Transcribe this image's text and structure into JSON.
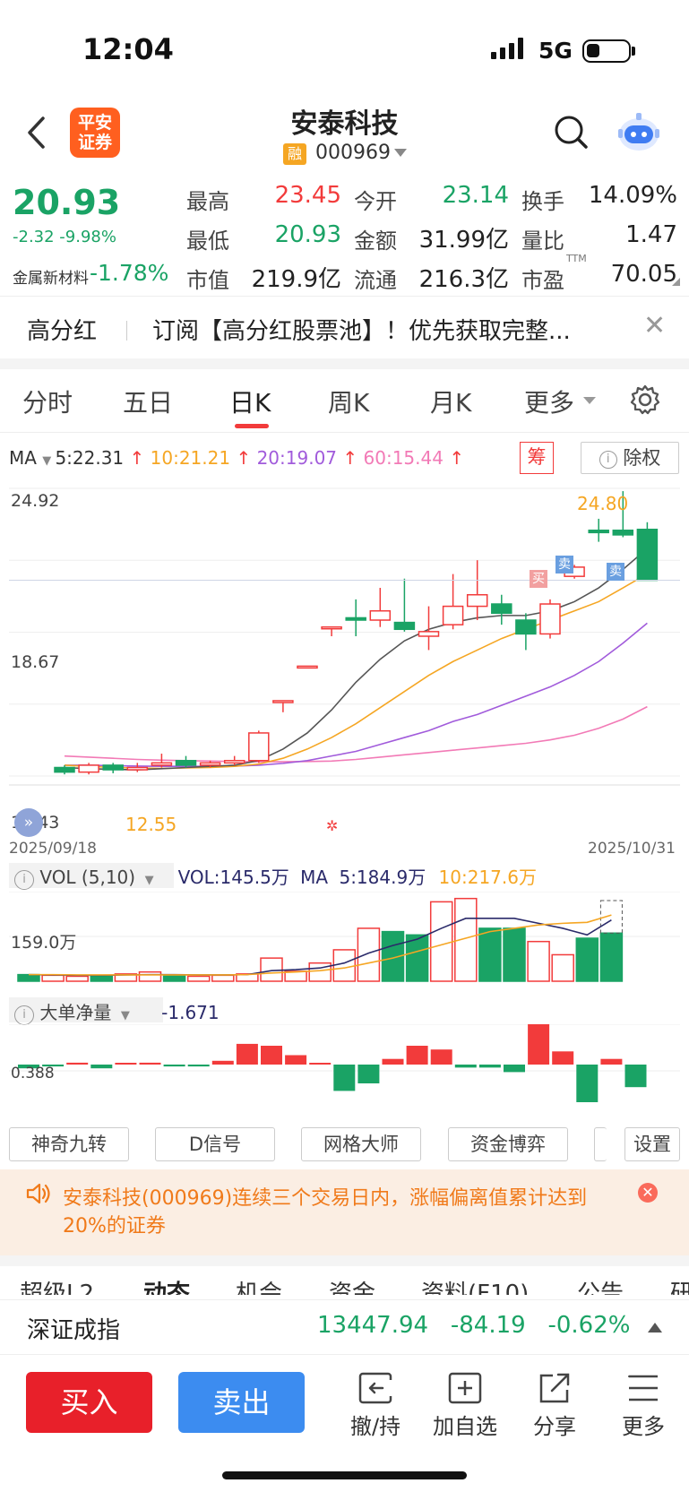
{
  "status_bar": {
    "time": "12:04",
    "network": "5G"
  },
  "header": {
    "logo_line1": "平安",
    "logo_line2": "证券",
    "stock_name": "安泰科技",
    "margin_tag": "融",
    "stock_code": "000969"
  },
  "quote": {
    "price": "20.93",
    "change": "-2.32  -9.98%",
    "sector_name": "金属新材料",
    "sector_change": "-1.78%",
    "fields": [
      {
        "label": "最高",
        "value": "23.45",
        "color": "#f23b3b"
      },
      {
        "label": "今开",
        "value": "23.14",
        "color": "#1aa365"
      },
      {
        "label": "换手",
        "value": "14.09%",
        "color": "#222222"
      },
      {
        "label": "最低",
        "value": "20.93",
        "color": "#1aa365"
      },
      {
        "label": "金额",
        "value": "31.99亿",
        "color": "#222222"
      },
      {
        "label": "量比",
        "value": "1.47",
        "color": "#222222"
      },
      {
        "label": "市值",
        "value": "219.9亿",
        "color": "#222222"
      },
      {
        "label": "流通",
        "value": "216.3亿",
        "color": "#222222"
      },
      {
        "label": "市盈",
        "value": "70.05",
        "color": "#222222"
      }
    ],
    "pe_suffix": "TTM"
  },
  "subscription": {
    "tag": "高分红",
    "text": "订阅【高分红股票池】！优先获取完整..."
  },
  "chart_tabs": [
    "分时",
    "五日",
    "日K",
    "周K",
    "月K",
    "更多"
  ],
  "chart_tabs_active": "日K",
  "ma_row": {
    "label": "MA",
    "ma5": "5:22.31",
    "ma10": "10:21.21",
    "ma20": "20:19.07",
    "ma60": "60:15.44",
    "chip_button": "筹",
    "rights_button": "除权"
  },
  "kline": {
    "y_high_label": "24.92",
    "y_mid_label": "18.67",
    "y_low_label": "12.43",
    "high_marker": "24.80",
    "low_marker": "12.55",
    "buy_tag": "买",
    "sell_tag": "卖",
    "start_date": "2025/09/18",
    "end_date": "2025/10/31"
  },
  "volume": {
    "label": "VOL (5,10)",
    "vol": "VOL:145.5万",
    "ma_label": "MA",
    "ma5": "5:184.9万",
    "ma10": "10:217.6万",
    "y_label": "159.0万"
  },
  "indicator": {
    "label": "大单净量",
    "value": "-1.671",
    "y_label": "0.388"
  },
  "tool_buttons": [
    "神奇九转",
    "D信号",
    "网格大师",
    "资金博弈",
    "设置"
  ],
  "alert": {
    "text": "安泰科技(000969)连续三个交易日内，涨幅偏离值累计达到20%的证券"
  },
  "info_tabs": [
    "超级L2",
    "动态",
    "机会",
    "资金",
    "资料(F10)",
    "公告",
    "研"
  ],
  "index_bar": {
    "name": "深证成指",
    "value": "13447.94",
    "change": "-84.19",
    "pct": "-0.62%"
  },
  "bottom_bar": {
    "buy": "买入",
    "sell": "卖出",
    "items": [
      "撤/持",
      "加自选",
      "分享",
      "更多"
    ]
  },
  "colors": {
    "up": "#f23b3b",
    "down": "#1aa365",
    "accent": "#e8202a",
    "sell_blue": "#3c8cf0"
  },
  "chart_data": [
    {
      "type": "candlestick",
      "title": "",
      "x_range": [
        "2025/09/18",
        "2025/10/31"
      ],
      "y_axis_labels": [
        "24.92",
        "18.67",
        "12.43"
      ],
      "ylim": [
        12.43,
        24.92
      ],
      "candles": [
        {
          "o": 12.8,
          "c": 12.6,
          "h": 12.9,
          "l": 12.5
        },
        {
          "o": 12.6,
          "c": 12.9,
          "h": 13.0,
          "l": 12.5
        },
        {
          "o": 12.9,
          "c": 12.7,
          "h": 13.0,
          "l": 12.55
        },
        {
          "o": 12.7,
          "c": 12.8,
          "h": 13.0,
          "l": 12.6
        },
        {
          "o": 12.9,
          "c": 13.0,
          "h": 13.4,
          "l": 12.8
        },
        {
          "o": 13.1,
          "c": 12.9,
          "h": 13.3,
          "l": 12.8
        },
        {
          "o": 12.9,
          "c": 13.0,
          "h": 13.1,
          "l": 12.8
        },
        {
          "o": 13.0,
          "c": 13.1,
          "h": 13.3,
          "l": 12.9
        },
        {
          "o": 13.1,
          "c": 14.3,
          "h": 14.4,
          "l": 13.0
        },
        {
          "o": 15.7,
          "c": 15.7,
          "h": 15.7,
          "l": 15.2
        },
        {
          "o": 17.2,
          "c": 17.2,
          "h": 17.2,
          "l": 17.2
        },
        {
          "o": 18.9,
          "c": 18.9,
          "h": 18.9,
          "l": 18.5
        },
        {
          "o": 19.3,
          "c": 19.2,
          "h": 20.1,
          "l": 18.5
        },
        {
          "o": 19.2,
          "c": 19.6,
          "h": 20.6,
          "l": 18.9
        },
        {
          "o": 19.1,
          "c": 18.8,
          "h": 21.0,
          "l": 18.7
        },
        {
          "o": 18.5,
          "c": 18.7,
          "h": 19.8,
          "l": 17.9
        },
        {
          "o": 19.0,
          "c": 19.8,
          "h": 21.2,
          "l": 18.8
        },
        {
          "o": 19.8,
          "c": 20.3,
          "h": 21.8,
          "l": 19.2
        },
        {
          "o": 19.9,
          "c": 19.5,
          "h": 20.3,
          "l": 19.0
        },
        {
          "o": 19.2,
          "c": 18.6,
          "h": 19.5,
          "l": 17.9
        },
        {
          "o": 18.6,
          "c": 19.9,
          "h": 20.1,
          "l": 18.4
        },
        {
          "o": 21.1,
          "c": 21.5,
          "h": 21.6,
          "l": 21.0
        },
        {
          "o": 23.1,
          "c": 23.0,
          "h": 23.6,
          "l": 22.6
        },
        {
          "o": 23.1,
          "c": 22.9,
          "h": 24.8,
          "l": 22.8
        },
        {
          "o": 23.14,
          "c": 20.93,
          "h": 23.45,
          "l": 20.93
        }
      ],
      "ma5": [
        12.8,
        12.75,
        12.72,
        12.7,
        12.75,
        12.8,
        12.85,
        12.9,
        13.1,
        13.6,
        14.3,
        15.3,
        16.5,
        17.5,
        18.3,
        18.8,
        19.1,
        19.3,
        19.4,
        19.4,
        19.6,
        20.0,
        20.6,
        21.4,
        22.31
      ],
      "ma10": [
        12.9,
        12.85,
        12.8,
        12.78,
        12.76,
        12.78,
        12.8,
        12.85,
        12.95,
        13.2,
        13.6,
        14.1,
        14.7,
        15.4,
        16.1,
        16.8,
        17.4,
        17.9,
        18.4,
        18.8,
        19.2,
        19.6,
        20.0,
        20.6,
        21.21
      ],
      "ma20": [
        12.9,
        12.9,
        12.88,
        12.86,
        12.85,
        12.85,
        12.85,
        12.86,
        12.9,
        12.98,
        13.1,
        13.3,
        13.5,
        13.8,
        14.1,
        14.4,
        14.8,
        15.1,
        15.5,
        15.9,
        16.3,
        16.8,
        17.4,
        18.2,
        19.07
      ],
      "ma60": [
        13.3,
        13.25,
        13.2,
        13.15,
        13.12,
        13.1,
        13.08,
        13.06,
        13.05,
        13.05,
        13.06,
        13.08,
        13.15,
        13.25,
        13.35,
        13.45,
        13.55,
        13.65,
        13.75,
        13.85,
        14.0,
        14.2,
        14.5,
        14.9,
        15.44
      ]
    },
    {
      "type": "bar",
      "title": "VOL (5,10)",
      "y_axis_labels": [
        "159.0万"
      ],
      "unit": "万",
      "values": [
        20,
        18,
        15,
        18,
        22,
        28,
        18,
        15,
        18,
        22,
        70,
        30,
        55,
        95,
        160,
        150,
        140,
        240,
        250,
        160,
        160,
        120,
        80,
        130,
        145.5
      ],
      "up": [
        false,
        true,
        true,
        false,
        true,
        true,
        false,
        true,
        true,
        true,
        true,
        true,
        true,
        true,
        true,
        false,
        false,
        true,
        true,
        false,
        false,
        true,
        true,
        false,
        false
      ],
      "ma5": [
        20,
        19,
        18,
        18,
        19,
        20,
        20,
        19,
        19,
        20,
        32,
        35,
        40,
        55,
        85,
        108,
        127,
        160,
        190,
        190,
        190,
        175,
        160,
        140,
        184.9
      ],
      "ma10": [
        20,
        20,
        19,
        19,
        19,
        19,
        19,
        19,
        19,
        20,
        25,
        28,
        32,
        40,
        55,
        70,
        90,
        110,
        130,
        150,
        160,
        170,
        175,
        178,
        217.6
      ]
    },
    {
      "type": "bar",
      "title": "大单净量",
      "y_axis_labels": [
        "0.388"
      ],
      "values": [
        -0.1,
        -0.05,
        0.05,
        -0.1,
        0.02,
        0.05,
        -0.05,
        -0.05,
        0.1,
        0.55,
        0.5,
        0.25,
        0.01,
        -0.7,
        -0.5,
        0.15,
        0.5,
        0.4,
        -0.08,
        -0.08,
        -0.2,
        1.3,
        0.35,
        -1.0,
        0.15,
        -0.6
      ]
    }
  ]
}
